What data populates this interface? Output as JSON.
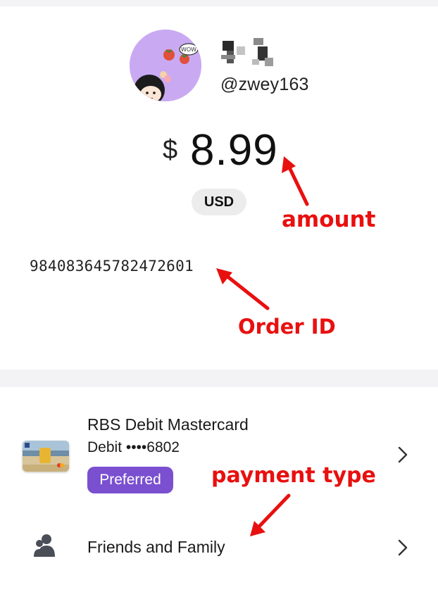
{
  "profile": {
    "handle": "@zwey163",
    "avatar_icon": "cartoon-girl-avatar",
    "avatar_bubble_text": "WOW"
  },
  "payment": {
    "currency_symbol": "$",
    "amount": "8.99",
    "currency_code": "USD",
    "order_id": "984083645782472601"
  },
  "method": {
    "card_name": "RBS Debit Mastercard",
    "card_detail": "Debit ••••6802",
    "preferred_label": "Preferred",
    "card_icon": "card-thumbnail-icon",
    "chevron_icon": "chevron-right-icon"
  },
  "transfer": {
    "type_label": "Friends and Family",
    "type_icon": "person-group-icon"
  },
  "annotations": {
    "amount": "amount",
    "order_id": "Order ID",
    "payment_type": "payment type",
    "color": "#e8100f"
  },
  "colors": {
    "accent": "#7a4fd0",
    "pill_bg": "#ececec",
    "divider": "#f3f3f5"
  }
}
